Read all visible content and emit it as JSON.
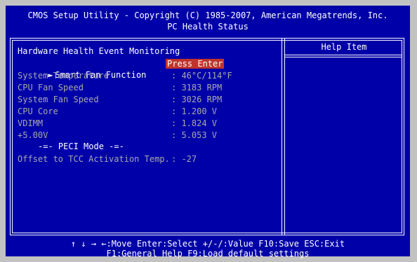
{
  "header": {
    "line1": "CMOS Setup Utility - Copyright (C) 1985-2007, American Megatrends, Inc.",
    "line2": "PC Health Status"
  },
  "main": {
    "section_title": "Hardware Health Event Monitoring",
    "items": [
      {
        "label": "Smart Fan Function",
        "value": "Press Enter"
      },
      {
        "label": "System Temperature",
        "value": ": 46°C/114°F"
      },
      {
        "label": "CPU Fan Speed",
        "value": ": 3183 RPM"
      },
      {
        "label": "System Fan Speed",
        "value": ": 3026 RPM"
      },
      {
        "label": "CPU Core",
        "value": ": 1.200 V"
      },
      {
        "label": "VDIMM",
        "value": ": 1.824 V"
      },
      {
        "label": "+5.00V",
        "value": ": 5.053 V"
      }
    ],
    "peci_header": "-=- PECI Mode -=-",
    "tcc": {
      "label": "Offset to TCC Activation Temp.",
      "value": ": -27"
    }
  },
  "help": {
    "title": "Help Item"
  },
  "footer": {
    "line1": "↑ ↓ → ←:Move  Enter:Select  +/-/:Value  F10:Save  ESC:Exit",
    "line2": "F1:General Help       F9:Load default settings"
  },
  "colors": {
    "background": "#0000a8",
    "highlight": "#c0342b",
    "dim_text": "#a8a8a8",
    "outer": "#c2c2c2"
  }
}
